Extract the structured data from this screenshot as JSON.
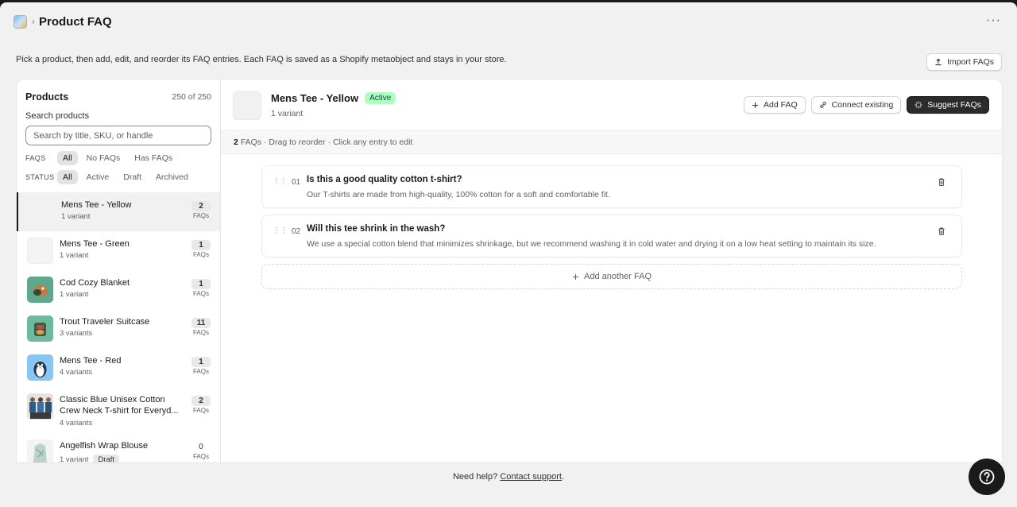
{
  "app": {
    "title": "Product FAQ",
    "breadcrumb_sep": "›",
    "menu_glyph": "···",
    "intro": "Pick a product, then add, edit, and reorder its FAQ entries. Each FAQ is saved as a Shopify metaobject and stays in your store.",
    "import_label": "Import FAQs"
  },
  "sidebar": {
    "title": "Products",
    "count": "250 of 250",
    "search_label": "Search products",
    "search_placeholder": "Search by title, SKU, or handle",
    "search_value": "",
    "faq_filter_label": "FAQS",
    "faq_filters": [
      "All",
      "No FAQs",
      "Has FAQs"
    ],
    "faq_filter_selected": "All",
    "status_filter_label": "STATUS",
    "status_filters": [
      "All",
      "Active",
      "Draft",
      "Archived"
    ],
    "status_filter_selected": "All",
    "faqs_unit": "FAQs",
    "products": [
      {
        "name": "Mens Tee - Yellow",
        "variants": "1 variant",
        "faqs": "2",
        "selected": true
      },
      {
        "name": "Mens Tee - Green",
        "variants": "1 variant",
        "faqs": "1"
      },
      {
        "name": "Cod Cozy Blanket",
        "variants": "1 variant",
        "faqs": "1"
      },
      {
        "name": "Trout Traveler Suitcase",
        "variants": "3 variants",
        "faqs": "11"
      },
      {
        "name": "Mens Tee - Red",
        "variants": "4 variants",
        "faqs": "1"
      },
      {
        "name": "Classic Blue Unisex Cotton Crew Neck T-shirt for Everyd...",
        "variants": "4 variants",
        "faqs": "2"
      },
      {
        "name": "Angelfish Wrap Blouse",
        "variants": "1 variant",
        "faqs": "0",
        "badge": "Draft"
      }
    ]
  },
  "main": {
    "product_title": "Mens Tee - Yellow",
    "status": "Active",
    "variants": "1 variant",
    "add_faq_label": "Add FAQ",
    "connect_label": "Connect existing",
    "suggest_label": "Suggest FAQs",
    "faq_count": "2",
    "info_text": "FAQs · Drag to reorder · Click any entry to edit",
    "faqs": [
      {
        "num": "01",
        "q": "Is this a good quality cotton t-shirt?",
        "a": "Our T-shirts are made from high-quality, 100% cotton for a soft and comfortable fit."
      },
      {
        "num": "02",
        "q": "Will this tee shrink in the wash?",
        "a": "We use a special cotton blend that minimizes shrinkage, but we recommend washing it in cold water and drying it on a low heat setting to maintain its size."
      }
    ],
    "add_another_label": "Add another FAQ"
  },
  "footer": {
    "prefix": "Need help?",
    "link": "Contact support",
    "suffix": "."
  },
  "colors": {
    "accent_dark": "#2b2b2b",
    "active_badge_bg": "#affebf",
    "active_badge_text": "#014b40"
  }
}
